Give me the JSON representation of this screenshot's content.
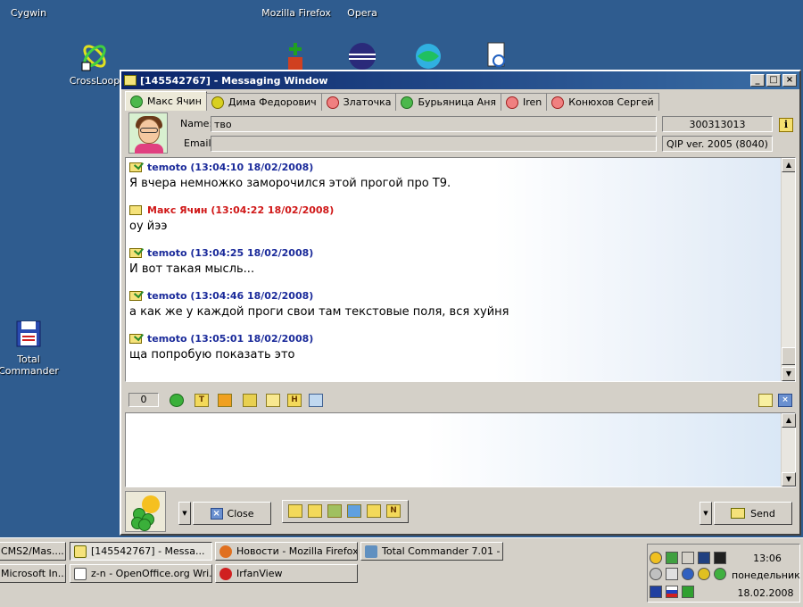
{
  "desktop": {
    "icons": [
      {
        "label": "Cygwin"
      },
      {
        "label": "Mozilla Firefox"
      },
      {
        "label": "Opera"
      },
      {
        "label": "CrossLoop"
      },
      {
        "label": "Total Commander"
      }
    ]
  },
  "window": {
    "title": "[145542767] - Messaging Window",
    "controls": {
      "minimize": "_",
      "maximize": "□",
      "close": "×"
    },
    "tabs": [
      {
        "label": "Макс Ячин",
        "status": "online"
      },
      {
        "label": "Дима Федорович",
        "status": "away"
      },
      {
        "label": "Златочка",
        "status": "offline"
      },
      {
        "label": "Бурьяница Аня",
        "status": "online"
      },
      {
        "label": "Iren",
        "status": "dnd"
      },
      {
        "label": "Конюхов Сергей",
        "status": "offline"
      }
    ],
    "contact": {
      "name_label": "Name:",
      "name_value": "тво",
      "email_label": "Email:",
      "email_value": "",
      "uin": "300313013",
      "client": "QIP ver. 2005 (8040)",
      "info_icon": "i"
    },
    "messages": [
      {
        "author": "temoto",
        "time": "(13:04:10 18/02/2008)",
        "text": "Я вчера немножко заморочился этой прогой про Т9.",
        "outgoing": true
      },
      {
        "author": "Макс Ячин",
        "time": "(13:04:22 18/02/2008)",
        "text": "оу йээ",
        "outgoing": false
      },
      {
        "author": "temoto",
        "time": "(13:04:25 18/02/2008)",
        "text": "И вот такая мысль...",
        "outgoing": true
      },
      {
        "author": "temoto",
        "time": "(13:04:46 18/02/2008)",
        "text": "а как же у каждой проги свои там текстовые поля, вся хуйня",
        "outgoing": true
      },
      {
        "author": "temoto",
        "time": "(13:05:01 18/02/2008)",
        "text": "ща попробую показать это",
        "outgoing": true
      }
    ],
    "char_counter": "0",
    "toolbar_icons": [
      "smile-icon",
      "T",
      "paint-icon",
      "save-icon",
      "star-icon",
      "H",
      "search-icon"
    ],
    "input_value": "",
    "close_label": "Close",
    "send_label": "Send",
    "format_icons": [
      "quote-icon",
      "list-icon",
      "history-icon",
      "users-icon",
      "copy-icon",
      "N"
    ]
  },
  "taskbar": {
    "tasks": [
      {
        "label": "CMS2/Mas...."
      },
      {
        "label": "[145542767] - Messa...",
        "active": true
      },
      {
        "label": "Новости - Mozilla Firefox"
      },
      {
        "label": "Total Commander 7.01 - ..."
      },
      {
        "label": "Microsoft In..."
      },
      {
        "label": "z-n - OpenOffice.org Wri..."
      },
      {
        "label": "IrfanView"
      }
    ],
    "clock": {
      "time": "13:06",
      "day": "понедельник",
      "date": "18.02.2008"
    }
  },
  "colors": {
    "desktop": "#2f5c8f",
    "outgoing_author": "#1a2a9a",
    "incoming_author": "#d01818",
    "titlebar": "#0a246a"
  }
}
